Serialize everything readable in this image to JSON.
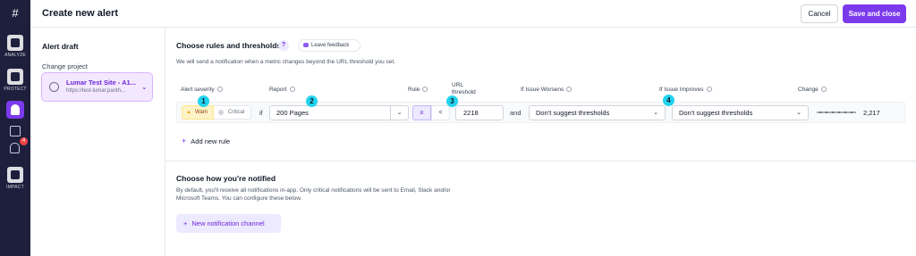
{
  "rail": {
    "items": [
      {
        "label": "ANALYZE",
        "icon": "analyze-icon"
      },
      {
        "label": "PROTECT",
        "icon": "protect-icon"
      },
      {
        "label": "IMPACT",
        "icon": "impact-icon"
      }
    ],
    "notification_count": "4",
    "brand_color": "#1e1f3d",
    "accent_color": "#7c3aed"
  },
  "header": {
    "title": "Create new alert",
    "cancel_label": "Cancel",
    "save_label": "Save and close"
  },
  "sidebar": {
    "title": "Alert draft",
    "change_project_label": "Change project",
    "project_name": "Lumar Test Site - A1...",
    "project_url": "https://test-lumar.panth..."
  },
  "rules": {
    "title": "Choose rules and thresholds",
    "help_glyph": "?",
    "feedback_label": "Leave feedback",
    "description": "We will send a notification when a metric changes beyond the URL threshold you set.",
    "columns": {
      "severity": "Alert severity",
      "report": "Report",
      "rule": "Rule",
      "url_threshold_line1": "URL",
      "url_threshold_line2": "threshold",
      "worsens": "If Issue Worsens",
      "improves": "If Issue Improves",
      "change": "Change"
    },
    "row": {
      "severity_warn": "Warn",
      "severity_critical": "Critical",
      "if_text": "if",
      "report_value": "200 Pages",
      "rule_gte": "≥",
      "rule_lt": "<",
      "threshold_value": "2218",
      "and_text": "and",
      "worsens_value": "Don't suggest thresholds",
      "improves_value": "Don't suggest thresholds",
      "change_value": "2,217"
    },
    "add_rule_label": "Add new rule"
  },
  "markers": [
    "1",
    "2",
    "3",
    "4"
  ],
  "notify": {
    "title": "Choose how you're notified",
    "description": "By default, you'll receive all notifications in-app. Only critical notifications will be sent to Email, Slack and/or Microsoft Teams. You can configure these below.",
    "new_channel_label": "New notification channel"
  }
}
